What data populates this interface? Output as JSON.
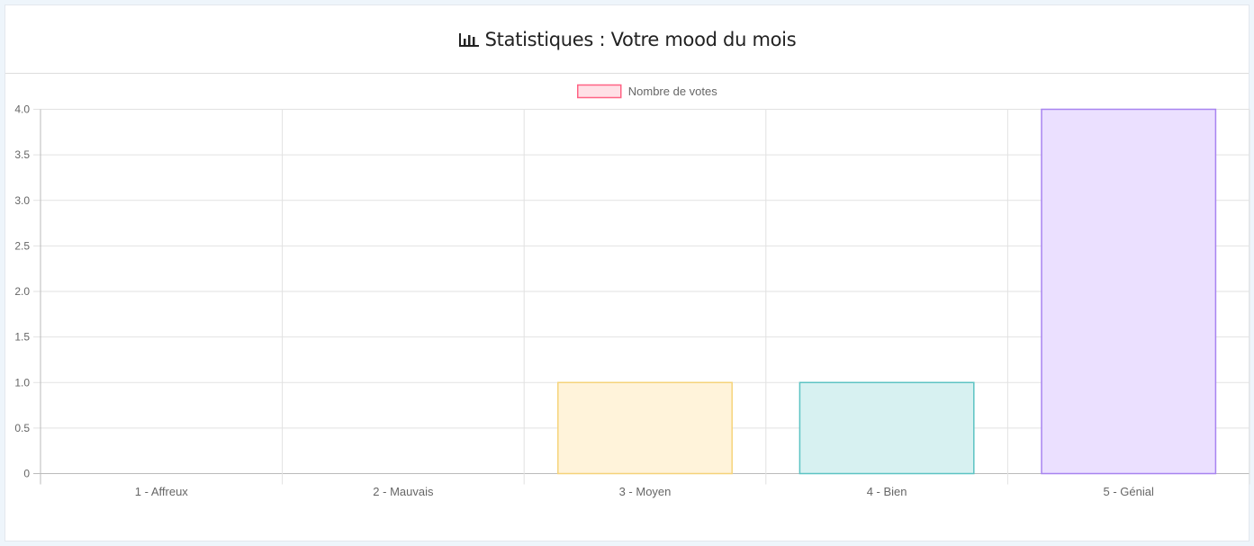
{
  "header": {
    "title": "Statistiques : Votre mood du mois",
    "icon": "bar-chart-icon"
  },
  "chart_data": {
    "type": "bar",
    "categories": [
      "1 - Affreux",
      "2 - Mauvais",
      "3 - Moyen",
      "4 - Bien",
      "5 - Génial"
    ],
    "series": [
      {
        "name": "Nombre de votes",
        "values": [
          0,
          0,
          1,
          1,
          4
        ],
        "fill_colors": [
          "#ffe0e6",
          "#ffe0e6",
          "#fff3da",
          "#d7f1f1",
          "#ebe0ff"
        ],
        "border_colors": [
          "#ff6384",
          "#ff6384",
          "#f5d37a",
          "#5cc3c3",
          "#a884f0"
        ]
      }
    ],
    "legend": {
      "position": "top",
      "label": "Nombre de votes",
      "fill": "#ffe0e6",
      "border": "#ff6384"
    },
    "ylim": [
      0,
      4
    ],
    "yticks": [
      "0",
      "0.5",
      "1.0",
      "1.5",
      "2.0",
      "2.5",
      "3.0",
      "3.5",
      "4.0"
    ],
    "ytick_values": [
      0,
      0.5,
      1,
      1.5,
      2,
      2.5,
      3,
      3.5,
      4
    ],
    "grid": true,
    "xlabel": "",
    "ylabel": ""
  }
}
